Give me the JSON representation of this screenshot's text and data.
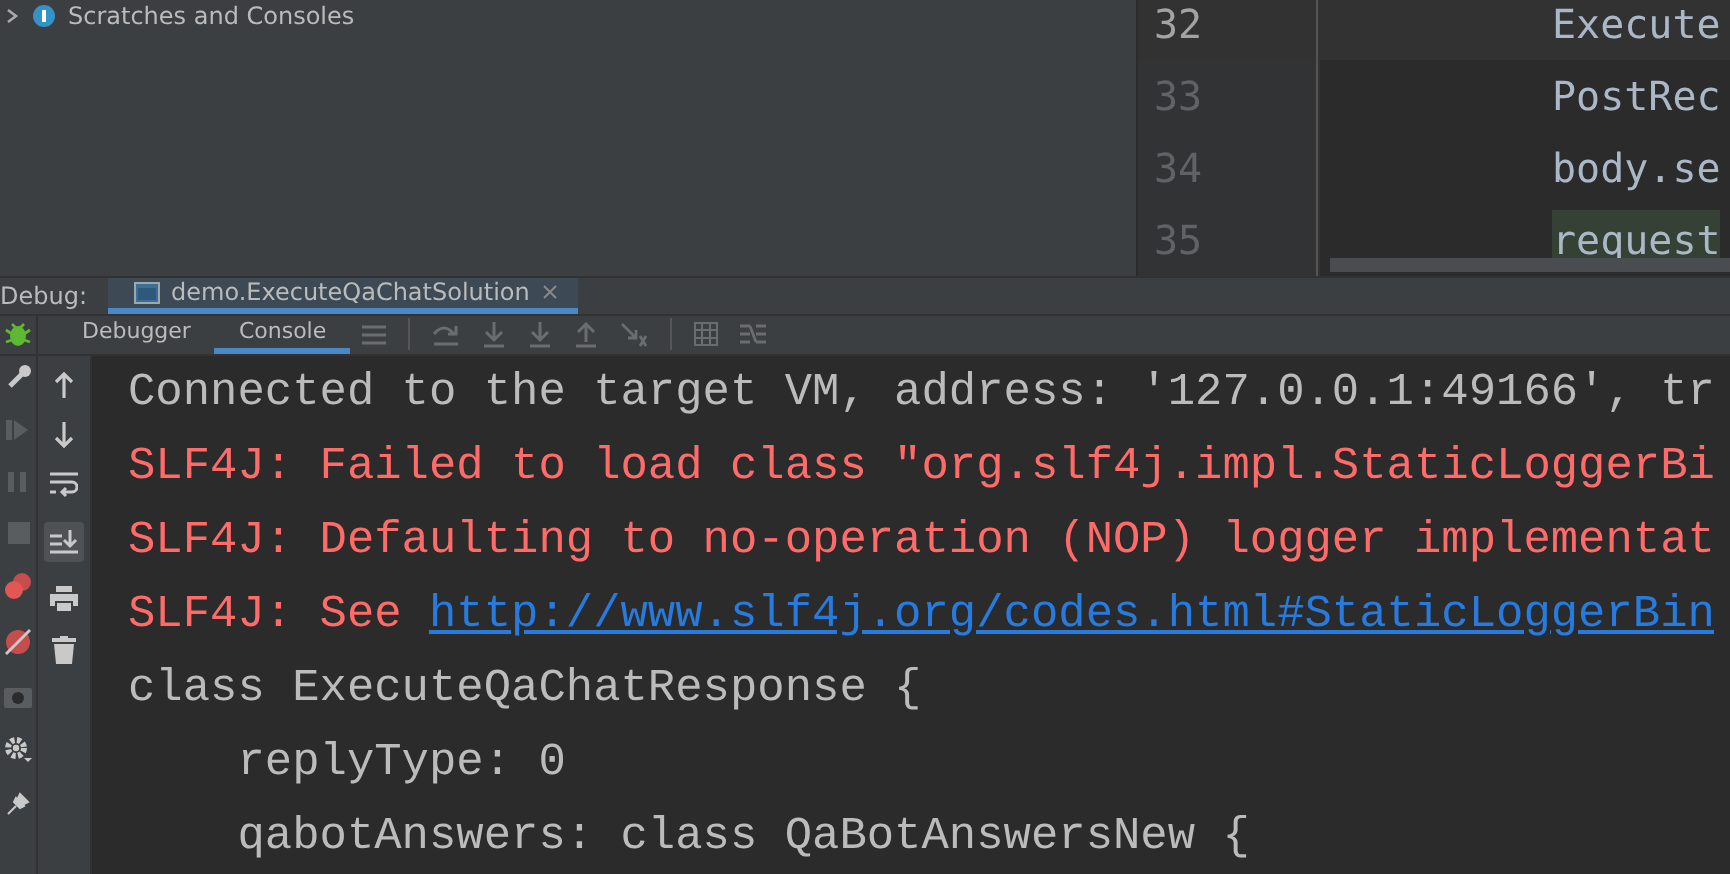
{
  "project_tree": {
    "item": "Scratches and Consoles"
  },
  "editor": {
    "lines": [
      {
        "number": "32",
        "code": "Execute",
        "current": true,
        "highlighted": false
      },
      {
        "number": "33",
        "code": "PostRec",
        "current": false,
        "highlighted": false
      },
      {
        "number": "34",
        "code": "body.se",
        "current": false,
        "highlighted": false
      },
      {
        "number": "35",
        "code": "request",
        "current": false,
        "highlighted": true
      }
    ]
  },
  "debug": {
    "label": "Debug:",
    "session_tab": {
      "title": "demo.ExecuteQaChatSolution",
      "selected": true
    },
    "tabs": [
      {
        "label": "Debugger",
        "selected": false
      },
      {
        "label": "Console",
        "selected": true
      }
    ]
  },
  "console": {
    "lines": [
      {
        "kind": "normal",
        "text": "Connected to the target VM, address: '127.0.0.1:49166', tr"
      },
      {
        "kind": "error",
        "text": "SLF4J: Failed to load class \"org.slf4j.impl.StaticLoggerBi"
      },
      {
        "kind": "error",
        "text": "SLF4J: Defaulting to no-operation (NOP) logger implementat"
      },
      {
        "kind": "error",
        "text": "SLF4J: See ",
        "link": "http://www.slf4j.org/codes.html#StaticLoggerBin"
      },
      {
        "kind": "normal",
        "text": "class ExecuteQaChatResponse {"
      },
      {
        "kind": "normal",
        "text": "    replyType: 0"
      },
      {
        "kind": "normal",
        "text": "    qabotAnswers: class QaBotAnswersNew {"
      }
    ]
  }
}
